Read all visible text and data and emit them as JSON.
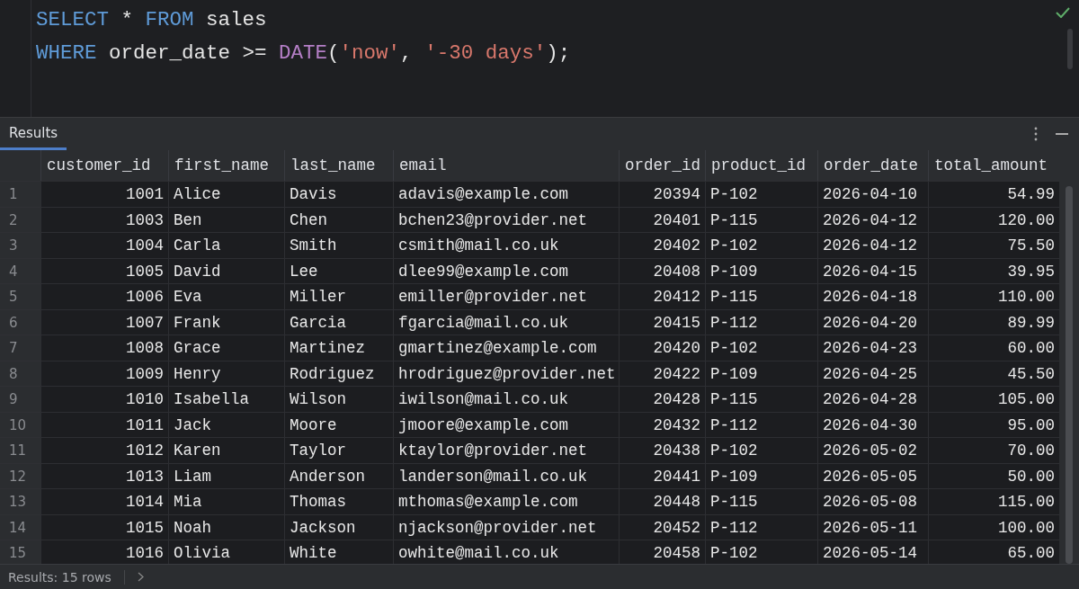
{
  "editor": {
    "lines": [
      [
        {
          "kind": "keyword",
          "text": "SELECT"
        },
        {
          "kind": "plain",
          "text": " * "
        },
        {
          "kind": "keyword",
          "text": "FROM"
        },
        {
          "kind": "plain",
          "text": " sales"
        }
      ],
      [
        {
          "kind": "keyword",
          "text": "WHERE"
        },
        {
          "kind": "plain",
          "text": " order_date >= "
        },
        {
          "kind": "function",
          "text": "DATE"
        },
        {
          "kind": "plain",
          "text": "("
        },
        {
          "kind": "string",
          "text": "'now'"
        },
        {
          "kind": "plain",
          "text": ", "
        },
        {
          "kind": "string",
          "text": "'-30 days'"
        },
        {
          "kind": "plain",
          "text": ");"
        }
      ]
    ]
  },
  "results_panel": {
    "tabs": [
      {
        "label": "Results",
        "selected": true
      }
    ]
  },
  "table": {
    "columns": [
      {
        "label": "customer_id",
        "kind": "number"
      },
      {
        "label": "first_name",
        "kind": "text"
      },
      {
        "label": "last_name",
        "kind": "text"
      },
      {
        "label": "email",
        "kind": "text"
      },
      {
        "label": "order_id",
        "kind": "number"
      },
      {
        "label": "product_id",
        "kind": "text"
      },
      {
        "label": "order_date",
        "kind": "text"
      },
      {
        "label": "total_amount",
        "kind": "number"
      }
    ],
    "rows": [
      {
        "number": "1",
        "cells": [
          "1001",
          "Alice",
          "Davis",
          "adavis@example.com",
          "20394",
          "P-102",
          "2026-04-10",
          "54.99"
        ]
      },
      {
        "number": "2",
        "cells": [
          "1003",
          "Ben",
          "Chen",
          "bchen23@provider.net",
          "20401",
          "P-115",
          "2026-04-12",
          "120.00"
        ]
      },
      {
        "number": "3",
        "cells": [
          "1004",
          "Carla",
          "Smith",
          "csmith@mail.co.uk",
          "20402",
          "P-102",
          "2026-04-12",
          "75.50"
        ]
      },
      {
        "number": "4",
        "cells": [
          "1005",
          "David",
          "Lee",
          "dlee99@example.com",
          "20408",
          "P-109",
          "2026-04-15",
          "39.95"
        ]
      },
      {
        "number": "5",
        "cells": [
          "1006",
          "Eva",
          "Miller",
          "emiller@provider.net",
          "20412",
          "P-115",
          "2026-04-18",
          "110.00"
        ]
      },
      {
        "number": "6",
        "cells": [
          "1007",
          "Frank",
          "Garcia",
          "fgarcia@mail.co.uk",
          "20415",
          "P-112",
          "2026-04-20",
          "89.99"
        ]
      },
      {
        "number": "7",
        "cells": [
          "1008",
          "Grace",
          "Martinez",
          "gmartinez@example.com",
          "20420",
          "P-102",
          "2026-04-23",
          "60.00"
        ]
      },
      {
        "number": "8",
        "cells": [
          "1009",
          "Henry",
          "Rodriguez",
          "hrodriguez@provider.net",
          "20422",
          "P-109",
          "2026-04-25",
          "45.50"
        ]
      },
      {
        "number": "9",
        "cells": [
          "1010",
          "Isabella",
          "Wilson",
          "iwilson@mail.co.uk",
          "20428",
          "P-115",
          "2026-04-28",
          "105.00"
        ]
      },
      {
        "number": "10",
        "cells": [
          "1011",
          "Jack",
          "Moore",
          "jmoore@example.com",
          "20432",
          "P-112",
          "2026-04-30",
          "95.00"
        ]
      },
      {
        "number": "11",
        "cells": [
          "1012",
          "Karen",
          "Taylor",
          "ktaylor@provider.net",
          "20438",
          "P-102",
          "2026-05-02",
          "70.00"
        ]
      },
      {
        "number": "12",
        "cells": [
          "1013",
          "Liam",
          "Anderson",
          "landerson@mail.co.uk",
          "20441",
          "P-109",
          "2026-05-05",
          "50.00"
        ]
      },
      {
        "number": "13",
        "cells": [
          "1014",
          "Mia",
          "Thomas",
          "mthomas@example.com",
          "20448",
          "P-115",
          "2026-05-08",
          "115.00"
        ]
      },
      {
        "number": "14",
        "cells": [
          "1015",
          "Noah",
          "Jackson",
          "njackson@provider.net",
          "20452",
          "P-112",
          "2026-05-11",
          "100.00"
        ]
      },
      {
        "number": "15",
        "cells": [
          "1016",
          "Olivia",
          "White",
          "owhite@mail.co.uk",
          "20458",
          "P-102",
          "2026-05-14",
          "65.00"
        ]
      }
    ]
  },
  "status_bar": {
    "text": "Results: 15 rows"
  }
}
